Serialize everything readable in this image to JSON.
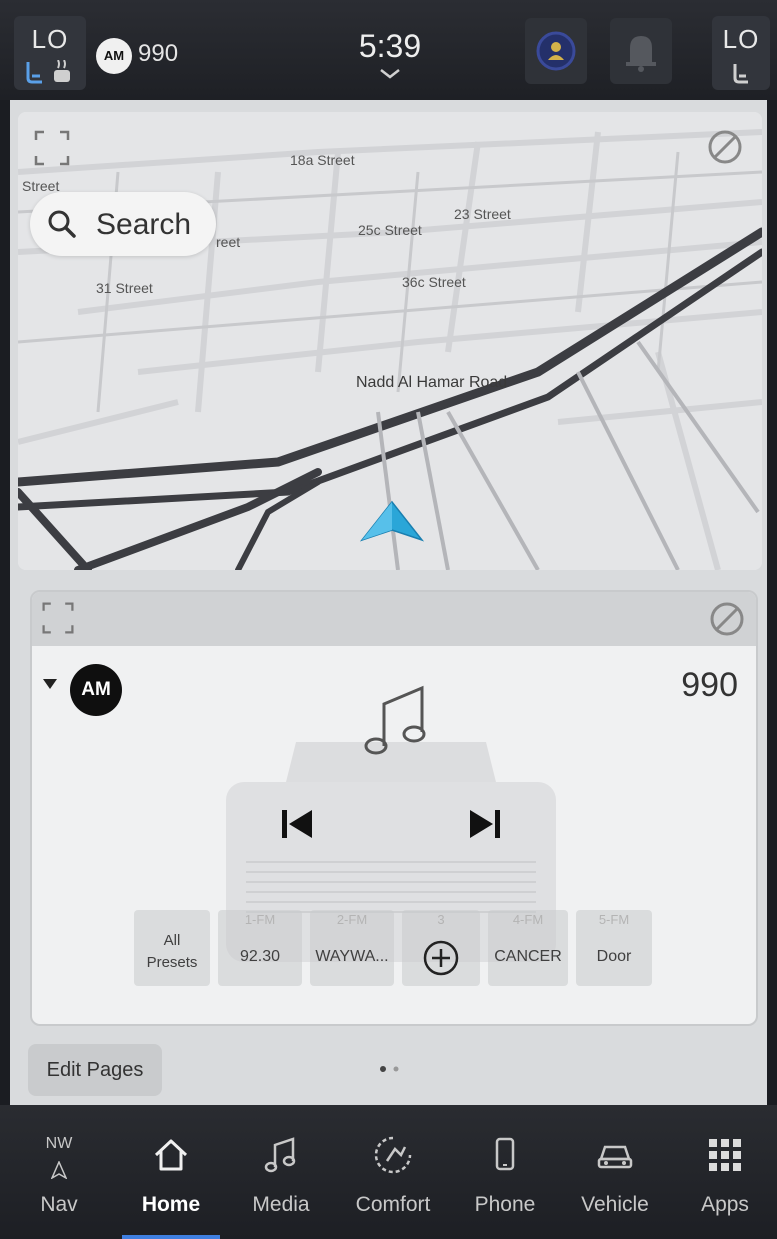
{
  "status_bar": {
    "left_climate_label": "LO",
    "radio_band": "AM",
    "radio_frequency": "990",
    "time": "5:39",
    "right_climate_label": "LO"
  },
  "map": {
    "search_label": "Search",
    "street_labels": [
      "18a Street",
      "Street",
      "23 Street",
      "25c Street",
      "reet",
      "31 Street",
      "36c Street"
    ],
    "road_label": "Nadd Al Hamar Road"
  },
  "media": {
    "source_band": "AM",
    "frequency": "990",
    "presets": [
      {
        "number": "",
        "label": "All\nPresets"
      },
      {
        "number": "1-FM",
        "label": "92.30"
      },
      {
        "number": "2-FM",
        "label": "WAYWA..."
      },
      {
        "number": "3",
        "label": ""
      },
      {
        "number": "4-FM",
        "label": "CANCER"
      },
      {
        "number": "5-FM",
        "label": "Door"
      }
    ]
  },
  "edit_pages_label": "Edit Pages",
  "bottom_nav": {
    "compass_direction": "NW",
    "items": [
      {
        "label": "Nav",
        "icon": "compass-icon"
      },
      {
        "label": "Home",
        "icon": "home-icon"
      },
      {
        "label": "Media",
        "icon": "music-note-icon"
      },
      {
        "label": "Comfort",
        "icon": "comfort-icon"
      },
      {
        "label": "Phone",
        "icon": "phone-icon"
      },
      {
        "label": "Vehicle",
        "icon": "vehicle-icon"
      },
      {
        "label": "Apps",
        "icon": "apps-grid-icon"
      }
    ],
    "active": "Home"
  },
  "colors": {
    "accent": "#3f7fe0",
    "nav_arrow": "#2aa6d8",
    "bar_background": "#1e2025"
  }
}
